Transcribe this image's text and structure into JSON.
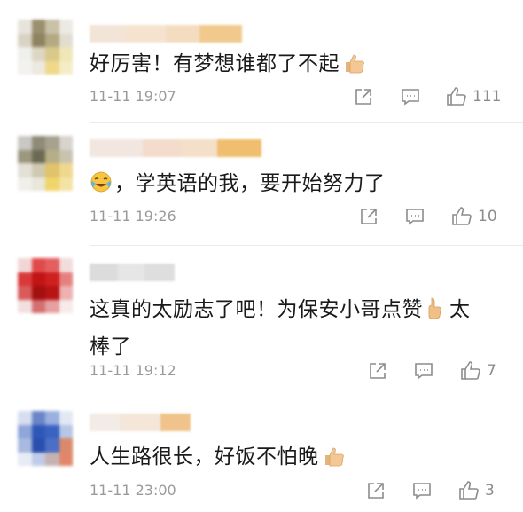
{
  "comments": [
    {
      "text": "好厉害！有梦想谁都了不起",
      "time": "11-11 19:07",
      "likes": "111",
      "icons": {
        "reply": "share-icon",
        "comment": "comment-icon",
        "like": "thumb-up-icon",
        "emoji": "thumbs-up-emoji"
      }
    },
    {
      "text": "，学英语的我，要开始努力了",
      "time": "11-11 19:26",
      "likes": "10",
      "icons": {
        "reply": "share-icon",
        "comment": "comment-icon",
        "like": "thumb-up-icon",
        "emoji": "crying-laughing-emoji"
      }
    },
    {
      "text": "这真的太励志了吧！为保安小哥点赞",
      "text_tail": "太",
      "text_line2": "棒了",
      "time": "11-11 19:12",
      "likes": "7",
      "icons": {
        "reply": "share-icon",
        "comment": "comment-icon",
        "like": "thumb-up-icon",
        "emoji": "thumbs-up-emoji"
      }
    },
    {
      "text": "人生路很长，好饭不怕晚",
      "time": "11-11 23:00",
      "likes": "3",
      "icons": {
        "reply": "share-icon",
        "comment": "comment-icon",
        "like": "thumb-up-icon",
        "emoji": "thumbs-up-emoji"
      }
    }
  ],
  "colors": {
    "meta_text": "#9a9a9a",
    "icon_stroke": "#8c8c8c",
    "divider": "#e9e9e9"
  }
}
